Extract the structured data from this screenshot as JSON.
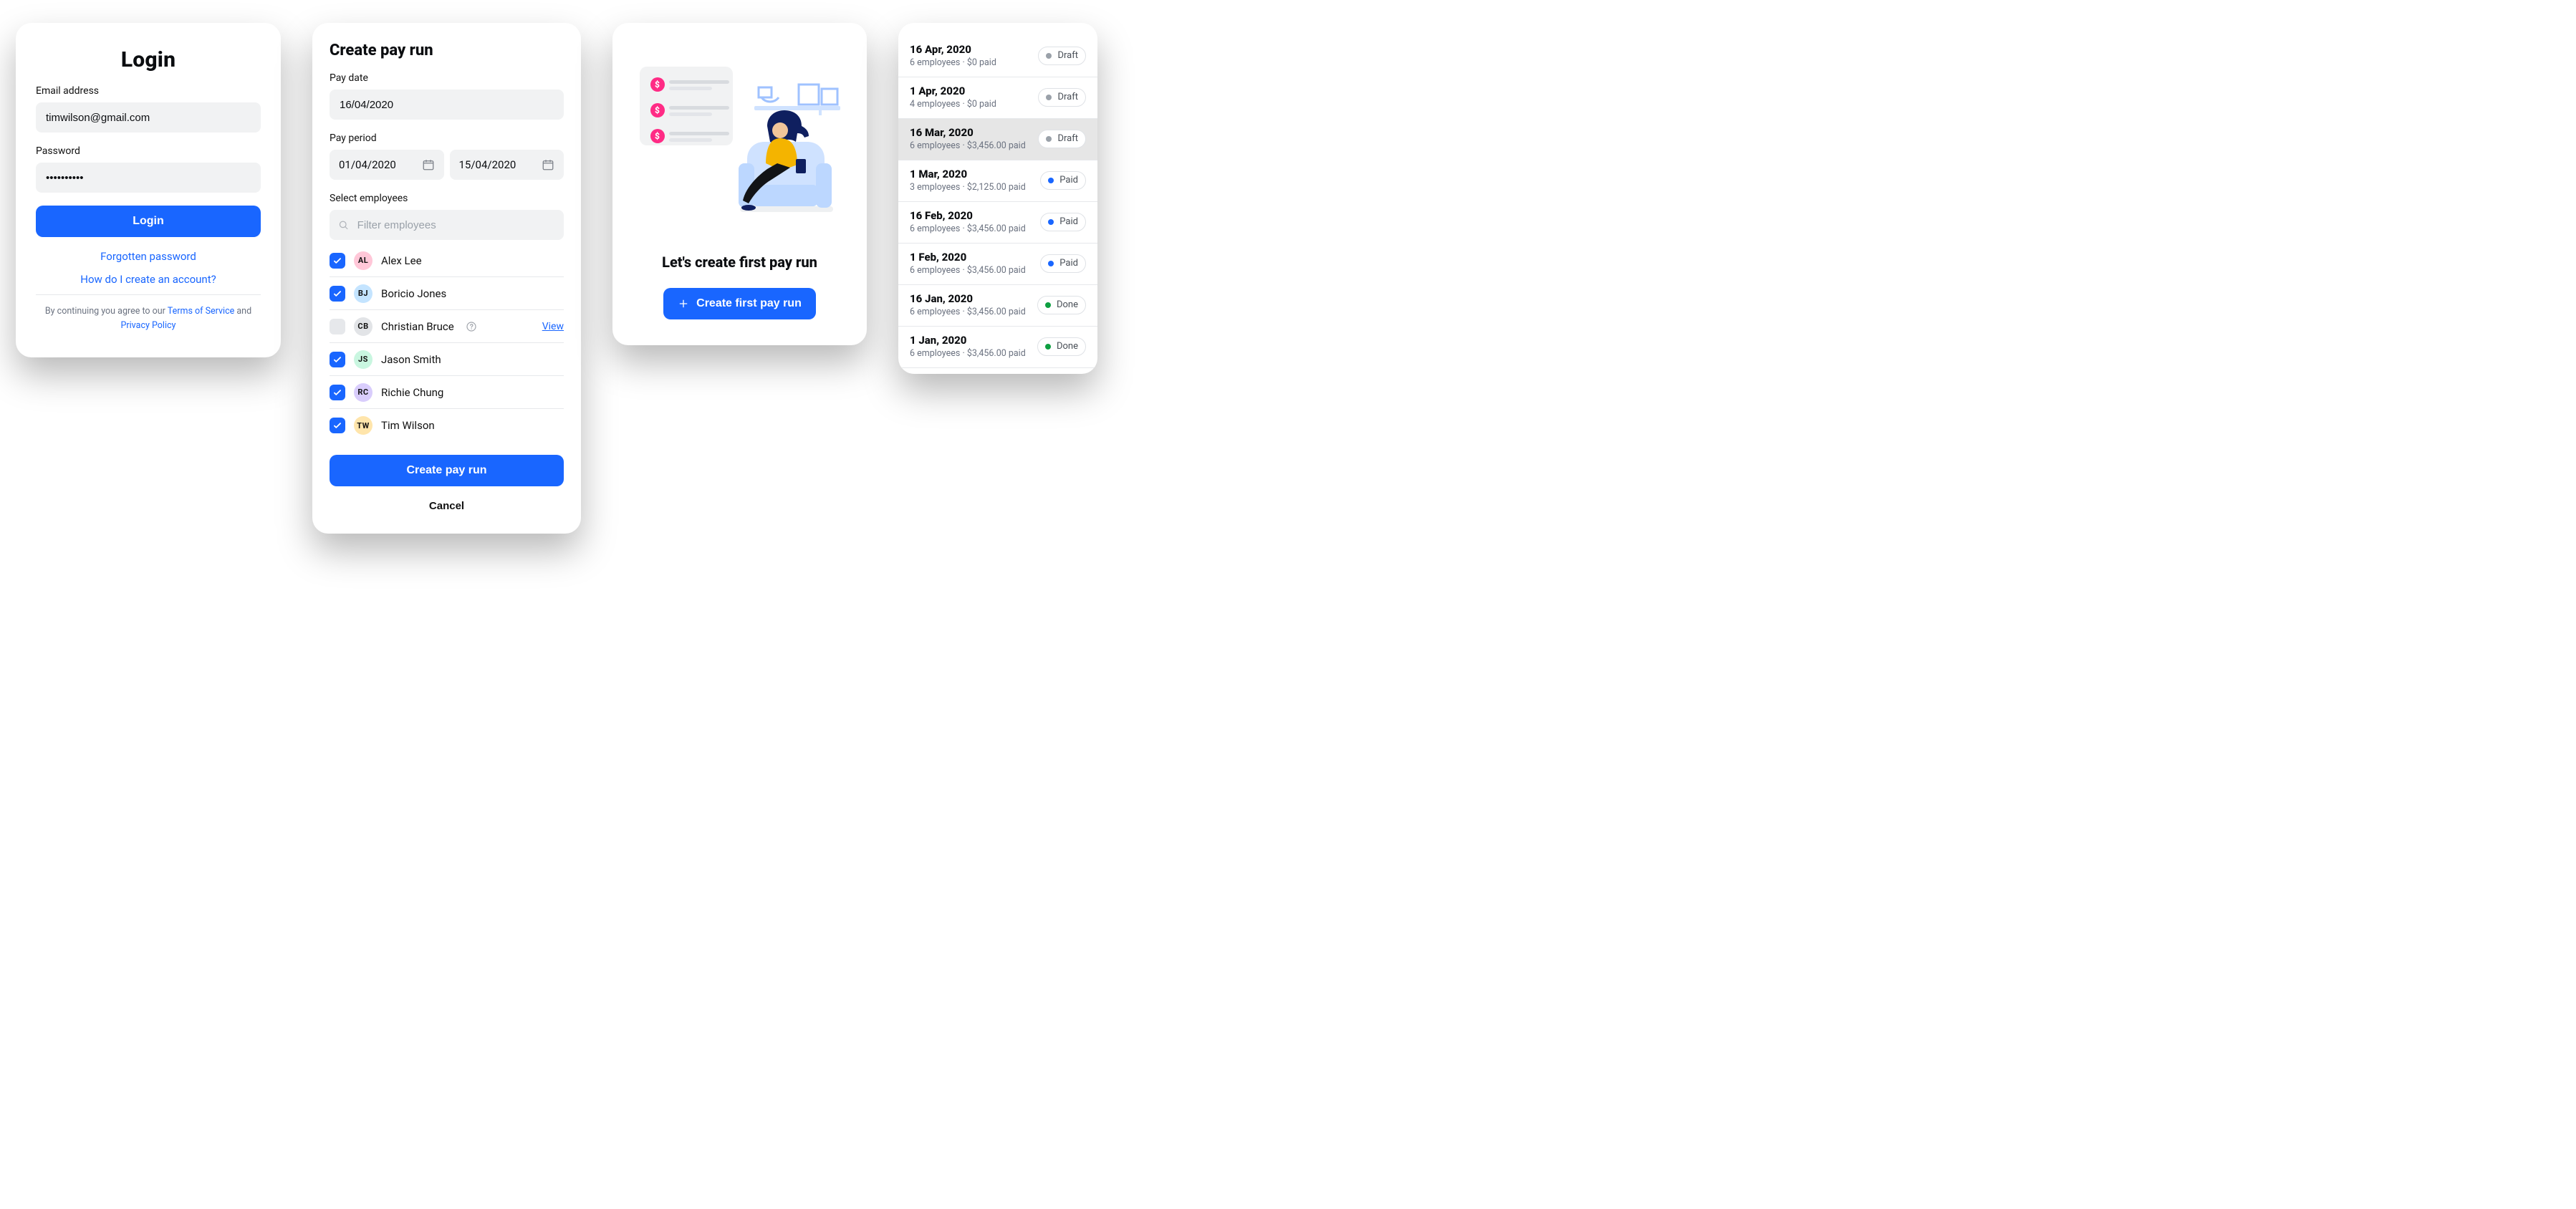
{
  "login": {
    "title": "Login",
    "email_label": "Email address",
    "email_value": "timwilson@gmail.com",
    "password_label": "Password",
    "password_value": "••••••••••",
    "submit_label": "Login",
    "forgot_label": "Forgotten password",
    "howto_label": "How do I create an account?",
    "legal_prefix": "By continuing you agree to our ",
    "terms_label": "Terms of Service",
    "and_label": " and ",
    "privacy_label": "Privacy Policy"
  },
  "create": {
    "title": "Create pay run",
    "paydate_label": "Pay date",
    "paydate_value": "16/04/2020",
    "payperiod_label": "Pay period",
    "period_from": "01/04/2020",
    "period_to": "15/04/2020",
    "select_label": "Select employees",
    "filter_placeholder": "Filter employees",
    "view_label": "View",
    "submit_label": "Create pay run",
    "cancel_label": "Cancel",
    "employees": [
      {
        "initials": "AL",
        "name": "Alex Lee",
        "checked": true,
        "color": "pink"
      },
      {
        "initials": "BJ",
        "name": "Boricio Jones",
        "checked": true,
        "color": "blue"
      },
      {
        "initials": "CB",
        "name": "Christian Bruce",
        "checked": false,
        "color": "gray",
        "has_question": true,
        "has_view": true
      },
      {
        "initials": "JS",
        "name": "Jason Smith",
        "checked": true,
        "color": "teal"
      },
      {
        "initials": "RC",
        "name": "Richie Chung",
        "checked": true,
        "color": "violet"
      },
      {
        "initials": "TW",
        "name": "Tim Wilson",
        "checked": true,
        "color": "gold"
      }
    ]
  },
  "empty": {
    "title": "Let's create first pay run",
    "cta_label": "Create first pay run"
  },
  "runs": {
    "items": [
      {
        "date": "16 Apr, 2020",
        "sub": "6 employees · $0 paid",
        "status": "Draft",
        "color": "gray",
        "selected": false
      },
      {
        "date": "1 Apr, 2020",
        "sub": "4 employees · $0 paid",
        "status": "Draft",
        "color": "gray",
        "selected": false
      },
      {
        "date": "16 Mar, 2020",
        "sub": "6 employees · $3,456.00 paid",
        "status": "Draft",
        "color": "gray",
        "selected": true
      },
      {
        "date": "1 Mar, 2020",
        "sub": "3 employees · $2,125.00 paid",
        "status": "Paid",
        "color": "blue",
        "selected": false
      },
      {
        "date": "16 Feb, 2020",
        "sub": "6 employees · $3,456.00 paid",
        "status": "Paid",
        "color": "blue",
        "selected": false
      },
      {
        "date": "1 Feb, 2020",
        "sub": "6 employees · $3,456.00 paid",
        "status": "Paid",
        "color": "blue",
        "selected": false
      },
      {
        "date": "16 Jan, 2020",
        "sub": "6 employees · $3,456.00 paid",
        "status": "Done",
        "color": "green",
        "selected": false
      },
      {
        "date": "1 Jan, 2020",
        "sub": "6 employees · $3,456.00 paid",
        "status": "Done",
        "color": "green",
        "selected": false
      }
    ]
  }
}
